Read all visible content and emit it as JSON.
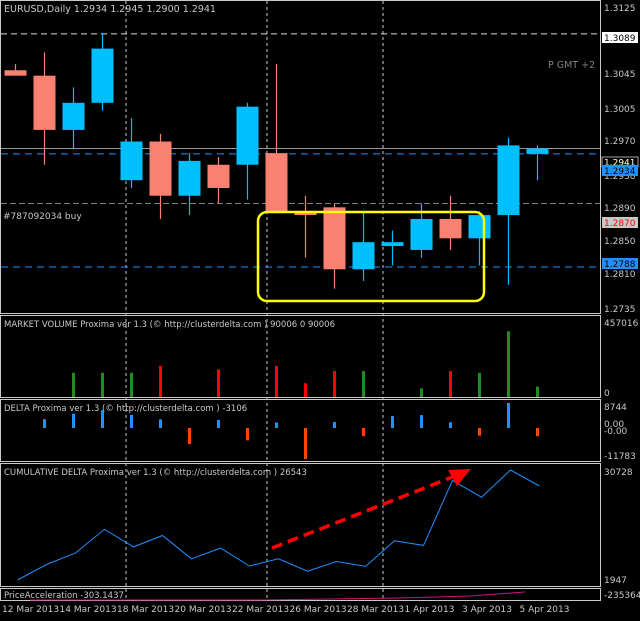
{
  "colors": {
    "background": "#000000",
    "bull": "#00bfff",
    "bear": "#fa8072",
    "grid": "#c8c8c8",
    "text": "#c8c8c8",
    "dash_line": "#1e90ff",
    "vol_up": "#228b22",
    "vol_down": "#ff0000",
    "delta_pos": "#1e90ff",
    "delta_neg": "#ff4500",
    "highlight": "#ffff00",
    "arrow": "#ff0000",
    "price_tag_bg": "#ffffff",
    "price_tag_text": "#000000",
    "cum_line": "#1e90ff",
    "accel_line": "#c71585"
  },
  "main": {
    "header": "EURUSD,Daily  1.2934 1.2945 1.2900 1.2941",
    "gmt_label": "P GMT +2",
    "order_label": "#787092034 buy",
    "price_ticks": [
      "1.3125",
      "1.3045",
      "1.3005",
      "1.2970",
      "1.2930",
      "1.2890",
      "1.2850",
      "1.2810",
      "1.2775",
      "1.2735"
    ],
    "tags": {
      "top": "1.3089",
      "current_1": "1.2941",
      "current_2": "1.2934",
      "order": "1.2870",
      "low": "1.2788"
    }
  },
  "panels": {
    "volume": {
      "label": "MARKET VOLUME Proxima ver 1.3 (© http://clusterdelta.com ) 90006 0 90006",
      "ticks": [
        "457016",
        "0"
      ]
    },
    "delta": {
      "label": "DELTA Proxima ver 1.3 (© http://clusterdelta.com ) -3106",
      "ticks": [
        "8744",
        "0.00",
        "-0.00",
        "-11783"
      ]
    },
    "cumulative": {
      "label": "CUMULATIVE DELTA Proxima ver 1.3 (© http://clusterdelta.com ) 26543",
      "ticks": [
        "30728",
        "1947"
      ]
    },
    "acceleration": {
      "label": "PriceAcceleration -303.1437",
      "tick": "-235364"
    }
  },
  "time_axis": [
    "12 Mar 2013",
    "14 Mar 2013",
    "18 Mar 2013",
    "20 Mar 2013",
    "22 Mar 2013",
    "26 Mar 2013",
    "28 Mar 2013",
    "1 Apr 2013",
    "3 Apr 2013",
    "5 Apr 2013"
  ],
  "chart_data": {
    "type": "candlestick",
    "title": "EURUSD,Daily",
    "price_range": [
      1.2735,
      1.3125
    ],
    "candles": [
      {
        "o": 1.3042,
        "h": 1.305,
        "l": 1.304,
        "c": 1.3035
      },
      {
        "o": 1.3035,
        "h": 1.3065,
        "l": 1.292,
        "c": 1.2965
      },
      {
        "o": 1.2965,
        "h": 1.302,
        "l": 1.294,
        "c": 1.3
      },
      {
        "o": 1.3,
        "h": 1.309,
        "l": 1.299,
        "c": 1.307
      },
      {
        "o": 1.29,
        "h": 1.298,
        "l": 1.289,
        "c": 1.295
      },
      {
        "o": 1.295,
        "h": 1.296,
        "l": 1.285,
        "c": 1.288
      },
      {
        "o": 1.288,
        "h": 1.2935,
        "l": 1.2855,
        "c": 1.2925
      },
      {
        "o": 1.292,
        "h": 1.293,
        "l": 1.287,
        "c": 1.289
      },
      {
        "o": 1.292,
        "h": 1.3,
        "l": 1.2875,
        "c": 1.2995
      },
      {
        "o": 1.2935,
        "h": 1.305,
        "l": 1.288,
        "c": 1.286
      },
      {
        "o": 1.286,
        "h": 1.288,
        "l": 1.28,
        "c": 1.2855
      },
      {
        "o": 1.2865,
        "h": 1.287,
        "l": 1.276,
        "c": 1.2785
      },
      {
        "o": 1.2785,
        "h": 1.286,
        "l": 1.277,
        "c": 1.282
      },
      {
        "o": 1.2815,
        "h": 1.2835,
        "l": 1.279,
        "c": 1.282
      },
      {
        "o": 1.281,
        "h": 1.287,
        "l": 1.28,
        "c": 1.285
      },
      {
        "o": 1.285,
        "h": 1.288,
        "l": 1.281,
        "c": 1.2825
      },
      {
        "o": 1.2825,
        "h": 1.286,
        "l": 1.279,
        "c": 1.2855
      },
      {
        "o": 1.2855,
        "h": 1.2955,
        "l": 1.2765,
        "c": 1.2945
      },
      {
        "o": 1.2934,
        "h": 1.2945,
        "l": 1.29,
        "c": 1.2941
      }
    ],
    "volume": [
      0,
      0,
      140000,
      140000,
      140000,
      180000,
      0,
      160000,
      0,
      180000,
      80000,
      150000,
      150000,
      0,
      50000,
      150000,
      140000,
      380000,
      60000
    ],
    "delta": [
      0,
      3100,
      5000,
      6200,
      4600,
      3000,
      -6100,
      2800,
      -4700,
      1900,
      -11783,
      2100,
      -3100,
      4200,
      4500,
      2000,
      -2900,
      8744,
      -3106
    ],
    "cumulative_delta": [
      1947,
      6000,
      9000,
      15200,
      10600,
      13600,
      7500,
      10300,
      5600,
      7500,
      4250,
      6800,
      5500,
      12200,
      11000,
      28000,
      23600,
      30728,
      26543
    ]
  }
}
